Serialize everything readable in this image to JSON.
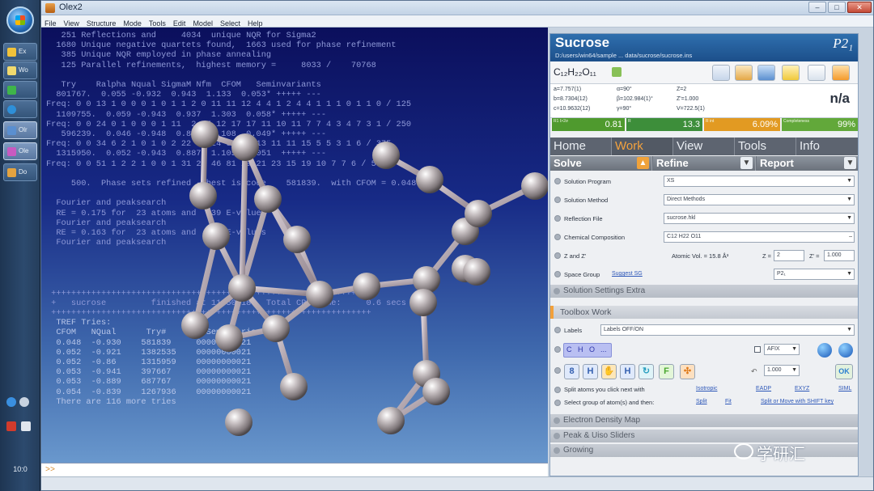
{
  "window": {
    "title": "Olex2",
    "buttons": {
      "minimize": "–",
      "maximize": "□",
      "close": "✕"
    }
  },
  "menu": [
    "File",
    "View",
    "Structure",
    "Mode",
    "Tools",
    "Edit",
    "Model",
    "Select",
    "Help"
  ],
  "taskbar": {
    "items": [
      {
        "label": "Ex",
        "icon_color": "#f0c23a"
      },
      {
        "label": "Wo",
        "icon_color": "#f0d96e"
      },
      {
        "label": "",
        "icon_color": "#3fb54a"
      },
      {
        "label": "",
        "icon_color": "#2e8fd8"
      },
      {
        "label": "Olr",
        "icon_color": "#5a8fd0"
      },
      {
        "label": "Ole",
        "icon_color": "#c85ac0"
      },
      {
        "label": "Do",
        "icon_color": "#e3a340"
      }
    ],
    "clock": "10:0"
  },
  "console": {
    "lines": [
      {
        "text": "   251 Reflections and     4034  unique NQR for Sigma2"
      },
      {
        "text": "  1680 Unique negative quartets found,  1663 used for phase refinement"
      },
      {
        "text": "   385 Unique NQR employed in phase annealing"
      },
      {
        "text": "   125 Parallel refinements,  highest memory =     8033 /    70768"
      },
      {
        "text": ""
      },
      {
        "text": "   Try    Ralpha Nqual SigmaM Nfm  CFOM   Seminvariants"
      },
      {
        "text": "  801767.  0.055 -0.932  0.943  1.133  0.053* +++++ ---"
      },
      {
        "text": "Freq: 0 0 13 1 0 0 0 1 0 1 1 2 0 11 11 12 4 4 1 2 4 4 1 1 1 0 1 1 0 / 125"
      },
      {
        "text": "  1109755.  0.059 -0.943  0.937  1.303  0.058* +++++ ---"
      },
      {
        "text": "Freq: 0 0 24 0 1 0 0 0 1 11  2 27 12 17 17 11 10 11 7 7 4 3 4 7 3 1 / 250"
      },
      {
        "text": "   596239.  0.046 -0.948  0.885  1.108  0.049* +++++ ---"
      },
      {
        "text": "Freq: 0 0 34 6 2 1 0 1 0 2 22 31 24 32 17 13 11 11 15 5 5 3 1 6 / 375"
      },
      {
        "text": "  1315950.  0.052 -0.943  0.887  1.105  0.051  +++++ ---"
      },
      {
        "text": "Freq: 0 0 51 1 2 2 1 0 0 1 31 29 46 81 29 21 23 15 19 10 7 7 6 / 500"
      },
      {
        "text": ""
      },
      {
        "text": "     500.  Phase sets refined - best is code    581839.  with CFOM = 0.0488"
      },
      {
        "text": ""
      },
      {
        "text": "  Fourier and peaksearch"
      },
      {
        "text": "  RE = 0.175 for  23 atoms and  439 E-values"
      },
      {
        "text": "  Fourier and peaksearch"
      },
      {
        "text": "  RE = 0.163 for  23 atoms and  439 E-values"
      },
      {
        "text": "  Fourier and peaksearch"
      },
      {
        "text": ""
      },
      {
        "text": " ++++++++++++++++++++++++++++++++++++++++++++++++++++++++++++++++"
      },
      {
        "text": " +   sucrose         finished at 11:50:18   Total CPU time:     0.6 secs   +"
      },
      {
        "text": " ++++++++++++++++++++++++++++++++++++++++++++++++++++++++++++++++"
      },
      {
        "text": "  TREF Tries:"
      },
      {
        "text": "  CFOM   NQual      Try#        Seminvariants"
      },
      {
        "text": "  0.048  -0.930    581839     00000000021"
      },
      {
        "text": "  0.052  -0.921    1382535    00000000021"
      },
      {
        "text": "  0.052  -0.86     1315959    00000000021"
      },
      {
        "text": "  0.053  -0.941    397667     00000000021"
      },
      {
        "text": "  0.053  -0.889    687767     00000000021"
      },
      {
        "text": "  0.054  -0.839    1267936    00000000021"
      },
      {
        "text": "  There are 116 more tries"
      }
    ],
    "command_prompt": ">>"
  },
  "panel": {
    "compound": "Sucrose",
    "path": "D:/users/win64/sample ... data/sucrose/sucrose.ins",
    "space_group": "P2₁",
    "formula": "C₁₂H₂₂O₁₁",
    "cell": {
      "a": "a=7.757(1)",
      "b": "b=8.7304(12)",
      "c": "c=10.9632(12)",
      "alpha": "α=90°",
      "beta": "β=102.984(1)°",
      "gamma": "γ=90°",
      "z": "Z=2",
      "zprime": "Z'=1.000",
      "volume": "V=722.5(1)"
    },
    "rfactor": "n/a",
    "stats": [
      {
        "tag": "R1\nI>2σ",
        "value": "0.81",
        "color": "#4f9a2e"
      },
      {
        "tag": "R",
        "value": "13.3",
        "color": "#3d8e3a"
      },
      {
        "tag": "R\nint",
        "value": "6.09%",
        "color": "#e29a22"
      },
      {
        "tag": "Completeness",
        "value": "99%",
        "color": "#62a83a"
      }
    ],
    "tabs": [
      "Home",
      "Work",
      "View",
      "Tools",
      "Info"
    ],
    "active_tab": "Work",
    "subtabs": [
      "Solve",
      "Refine",
      "Report"
    ],
    "form": {
      "solution_program": {
        "label": "Solution Program",
        "value": "XS"
      },
      "solution_method": {
        "label": "Solution Method",
        "value": "Direct Methods"
      },
      "reflection_file": {
        "label": "Reflection File",
        "value": "sucrose.hkl"
      },
      "chemical_composition": {
        "label": "Chemical Composition",
        "value": "C12 H22 O11"
      },
      "z_and_zprime": {
        "label": "Z and Z'",
        "atomic_vol": "Atomic Vol. = 15.8 Å³",
        "z_label": "Z =",
        "z_value": "2",
        "zprime_label": "Z' =",
        "zprime_value": "1.000"
      },
      "space_group": {
        "label": "Space Group",
        "link": "Suggest SG",
        "value": "P2₁"
      },
      "solution_settings": "Solution Settings Extra"
    },
    "toolbox": {
      "title": "Toolbox Work",
      "labels_label": "Labels",
      "labels_value": "Labels OFF/ON",
      "element_buttons": [
        "C",
        "H",
        "O",
        "..."
      ],
      "afix_value": "AFIX",
      "value_field": "1.000",
      "split_text": "Split atoms you click next with",
      "split_links": [
        "Isotropic",
        "EADP",
        "EXYZ",
        "SIML"
      ],
      "select_text": "Select group of atom(s) and then:",
      "select_links": [
        "Split",
        "Fit",
        "Split or Move with SHIFT key"
      ],
      "sections": [
        "Electron Density Map",
        "Peak & Uiso Sliders",
        "Growing"
      ]
    }
  },
  "watermark": "学研汇"
}
